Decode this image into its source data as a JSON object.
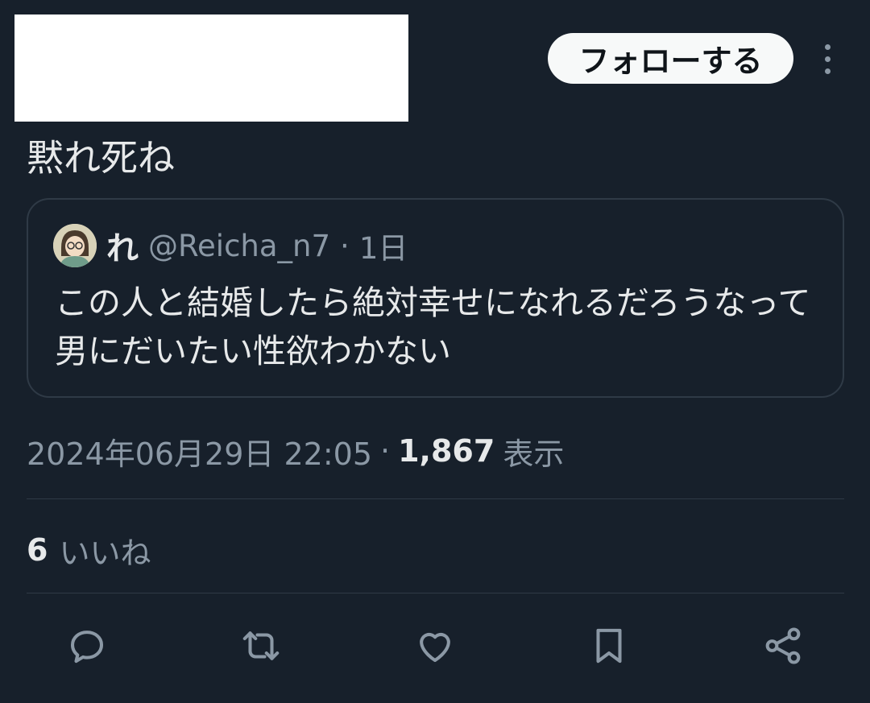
{
  "header": {
    "follow_label": "フォローする",
    "more_icon": "more-vertical-icon"
  },
  "tweet": {
    "text": "黙れ死ね"
  },
  "quote": {
    "avatar_icon": "user-avatar",
    "name": "れ",
    "handle": "@Reicha_n7",
    "separator": "·",
    "time": "1日",
    "text": "この人と結婚したら絶対幸せになれるだろうなって男にだいたい性欲わかない"
  },
  "meta": {
    "datetime": "2024年06月29日 22:05",
    "separator": "·",
    "views_count": "1,867",
    "views_label": "表示"
  },
  "stats": {
    "likes_count": "6",
    "likes_label": "いいね"
  },
  "actions": [
    {
      "icon": "reply-icon"
    },
    {
      "icon": "retweet-icon"
    },
    {
      "icon": "like-heart-icon"
    },
    {
      "icon": "bookmark-icon"
    },
    {
      "icon": "share-icon"
    }
  ],
  "colors": {
    "background": "#17202b",
    "text_primary": "#e7e9ea",
    "text_secondary": "#8b98a5",
    "border": "#2f3a46",
    "button_bg": "#f7f9f9"
  }
}
